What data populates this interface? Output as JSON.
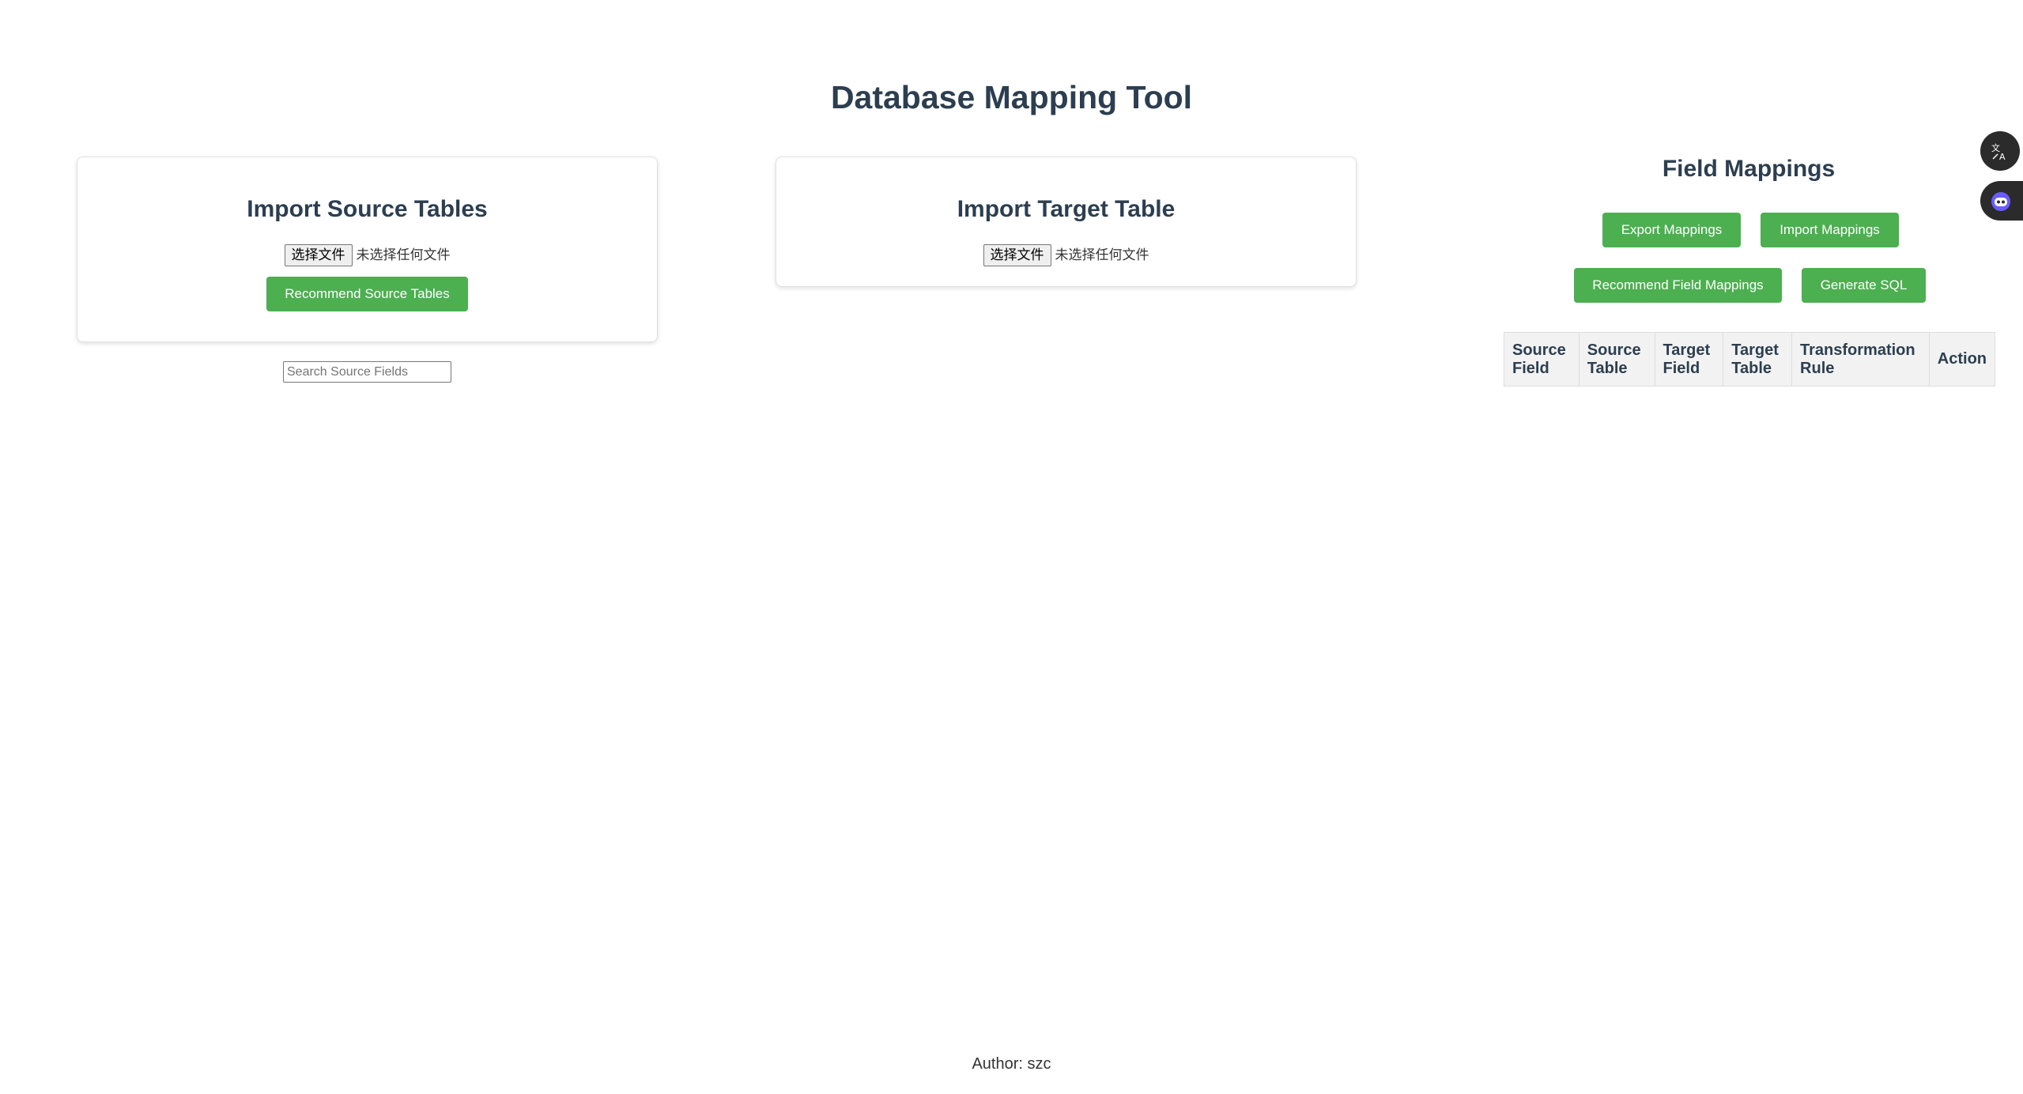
{
  "page": {
    "title": "Database Mapping Tool",
    "footer": "Author: szc"
  },
  "source_panel": {
    "title": "Import Source Tables",
    "file_button": "选择文件",
    "file_status": "未选择任何文件",
    "recommend_button": "Recommend Source Tables",
    "search_placeholder": "Search Source Fields"
  },
  "target_panel": {
    "title": "Import Target Table",
    "file_button": "选择文件",
    "file_status": "未选择任何文件"
  },
  "mappings_panel": {
    "title": "Field Mappings",
    "export_button": "Export Mappings",
    "import_button": "Import Mappings",
    "recommend_button": "Recommend Field Mappings",
    "generate_button": "Generate SQL",
    "columns": [
      "Source Field",
      "Source Table",
      "Target Field",
      "Target Table",
      "Transformation Rule",
      "Action"
    ]
  },
  "floating": {
    "translate_icon": "translate-icon",
    "assistant_icon": "assistant-icon"
  },
  "colors": {
    "accent": "#4caf50",
    "heading": "#2c3e50"
  }
}
